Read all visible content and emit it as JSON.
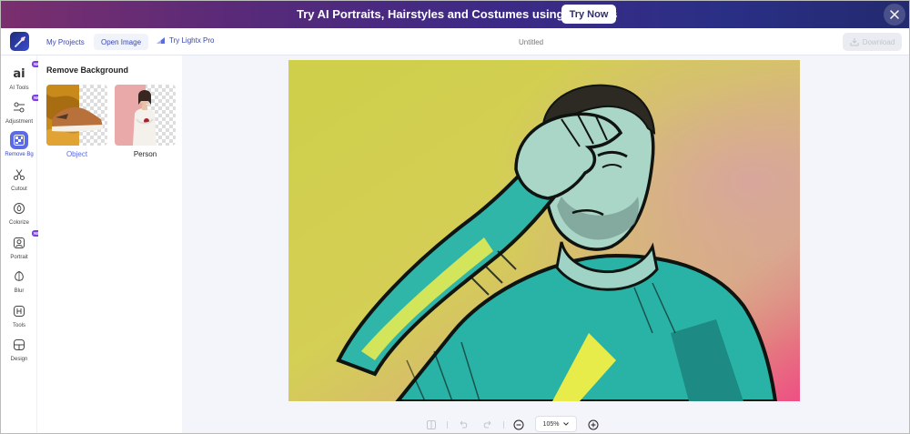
{
  "banner": {
    "text": "Try AI Portraits, Hairstyles and Costumes using AI Filters",
    "button": "Try Now"
  },
  "toolbar": {
    "my_projects": "My Projects",
    "open_image": "Open Image",
    "try_pro": "Try Lightx Pro",
    "title": "Untitled",
    "download": "Download"
  },
  "rail": {
    "new_badge": "NEW",
    "items": [
      {
        "label": "AI Tools",
        "icon": "ai-icon",
        "badge": true
      },
      {
        "label": "Adjustment",
        "icon": "sliders-icon",
        "badge": true
      },
      {
        "label": "Remove Bg",
        "icon": "remove-bg-icon",
        "active": true
      },
      {
        "label": "Cutout",
        "icon": "scissors-icon"
      },
      {
        "label": "Colorize",
        "icon": "droplet-icon"
      },
      {
        "label": "Portrait",
        "icon": "portrait-icon",
        "badge": true
      },
      {
        "label": "Blur",
        "icon": "blur-icon"
      },
      {
        "label": "Tools",
        "icon": "tools-icon"
      },
      {
        "label": "Design",
        "icon": "design-icon"
      }
    ]
  },
  "panel": {
    "title": "Remove Background",
    "options": [
      {
        "label": "Object",
        "selected": true
      },
      {
        "label": "Person",
        "selected": false
      }
    ]
  },
  "zoom": {
    "level": "105%"
  },
  "colors": {
    "accent": "#5b6be6",
    "accent_text": "#3a47b0",
    "badge": "#7b3fe4"
  }
}
